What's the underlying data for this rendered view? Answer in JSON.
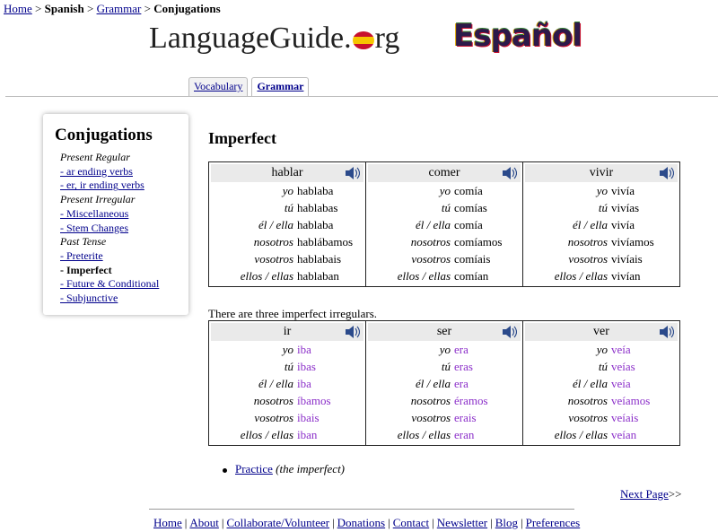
{
  "breadcrumb": {
    "home": "Home",
    "sep1": " > ",
    "spanish": "Spanish",
    "sep2": " > ",
    "grammar": "Grammar",
    "sep3": " > ",
    "current": "Conjugations"
  },
  "header": {
    "logo_left": "LanguageGuide.",
    "logo_right": "rg",
    "espanol": "Español"
  },
  "tabs": [
    {
      "label": "Vocabulary"
    },
    {
      "label": "Grammar"
    }
  ],
  "sidebar": {
    "title": "Conjugations",
    "items": [
      {
        "label": "Present Regular"
      },
      {
        "label": "- ar ending verbs"
      },
      {
        "label": "- er, ir ending verbs"
      },
      {
        "label": "Present Irregular"
      },
      {
        "label": "- Miscellaneous"
      },
      {
        "label": "- Stem Changes"
      },
      {
        "label": "Past Tense"
      },
      {
        "label": "- Preterite"
      },
      {
        "label": "- Imperfect"
      },
      {
        "label": "- Future & Conditional"
      },
      {
        "label": "- Subjunctive"
      }
    ]
  },
  "main": {
    "title": "Imperfect",
    "regular": [
      {
        "verb": "hablar",
        "forms": [
          "hablaba",
          "hablabas",
          "hablaba",
          "hablábamos",
          "hablabais",
          "hablaban"
        ]
      },
      {
        "verb": "comer",
        "forms": [
          "comía",
          "comías",
          "comía",
          "comíamos",
          "comíais",
          "comían"
        ]
      },
      {
        "verb": "vivir",
        "forms": [
          "vivía",
          "vivías",
          "vivía",
          "vivíamos",
          "vivíais",
          "vivían"
        ]
      }
    ],
    "pronouns": [
      "yo",
      "tú",
      "él / ella",
      "nosotros",
      "vosotros",
      "ellos / ellas"
    ],
    "irregular_note": "There are three imperfect irregulars.",
    "irregular": [
      {
        "verb": "ir",
        "forms": [
          "iba",
          "ibas",
          "iba",
          "íbamos",
          "ibais",
          "iban"
        ]
      },
      {
        "verb": "ser",
        "forms": [
          "era",
          "eras",
          "era",
          "éramos",
          "erais",
          "eran"
        ]
      },
      {
        "verb": "ver",
        "forms": [
          "veía",
          "veías",
          "veía",
          "veíamos",
          "veíais",
          "veían"
        ]
      }
    ],
    "practice_link": "Practice",
    "practice_note": " (the imperfect)",
    "next_link": "Next Page",
    "next_arrows": ">>"
  },
  "footer": {
    "links": [
      "Home",
      "About",
      "Collaborate/Volunteer",
      "Donations",
      "Contact",
      "Newsletter",
      "Blog",
      "Preferences"
    ],
    "separator": "|"
  },
  "colors": {
    "link": "#00008b",
    "irregular_verb": "#8b2fc9",
    "header_bg": "#eaeaea"
  }
}
